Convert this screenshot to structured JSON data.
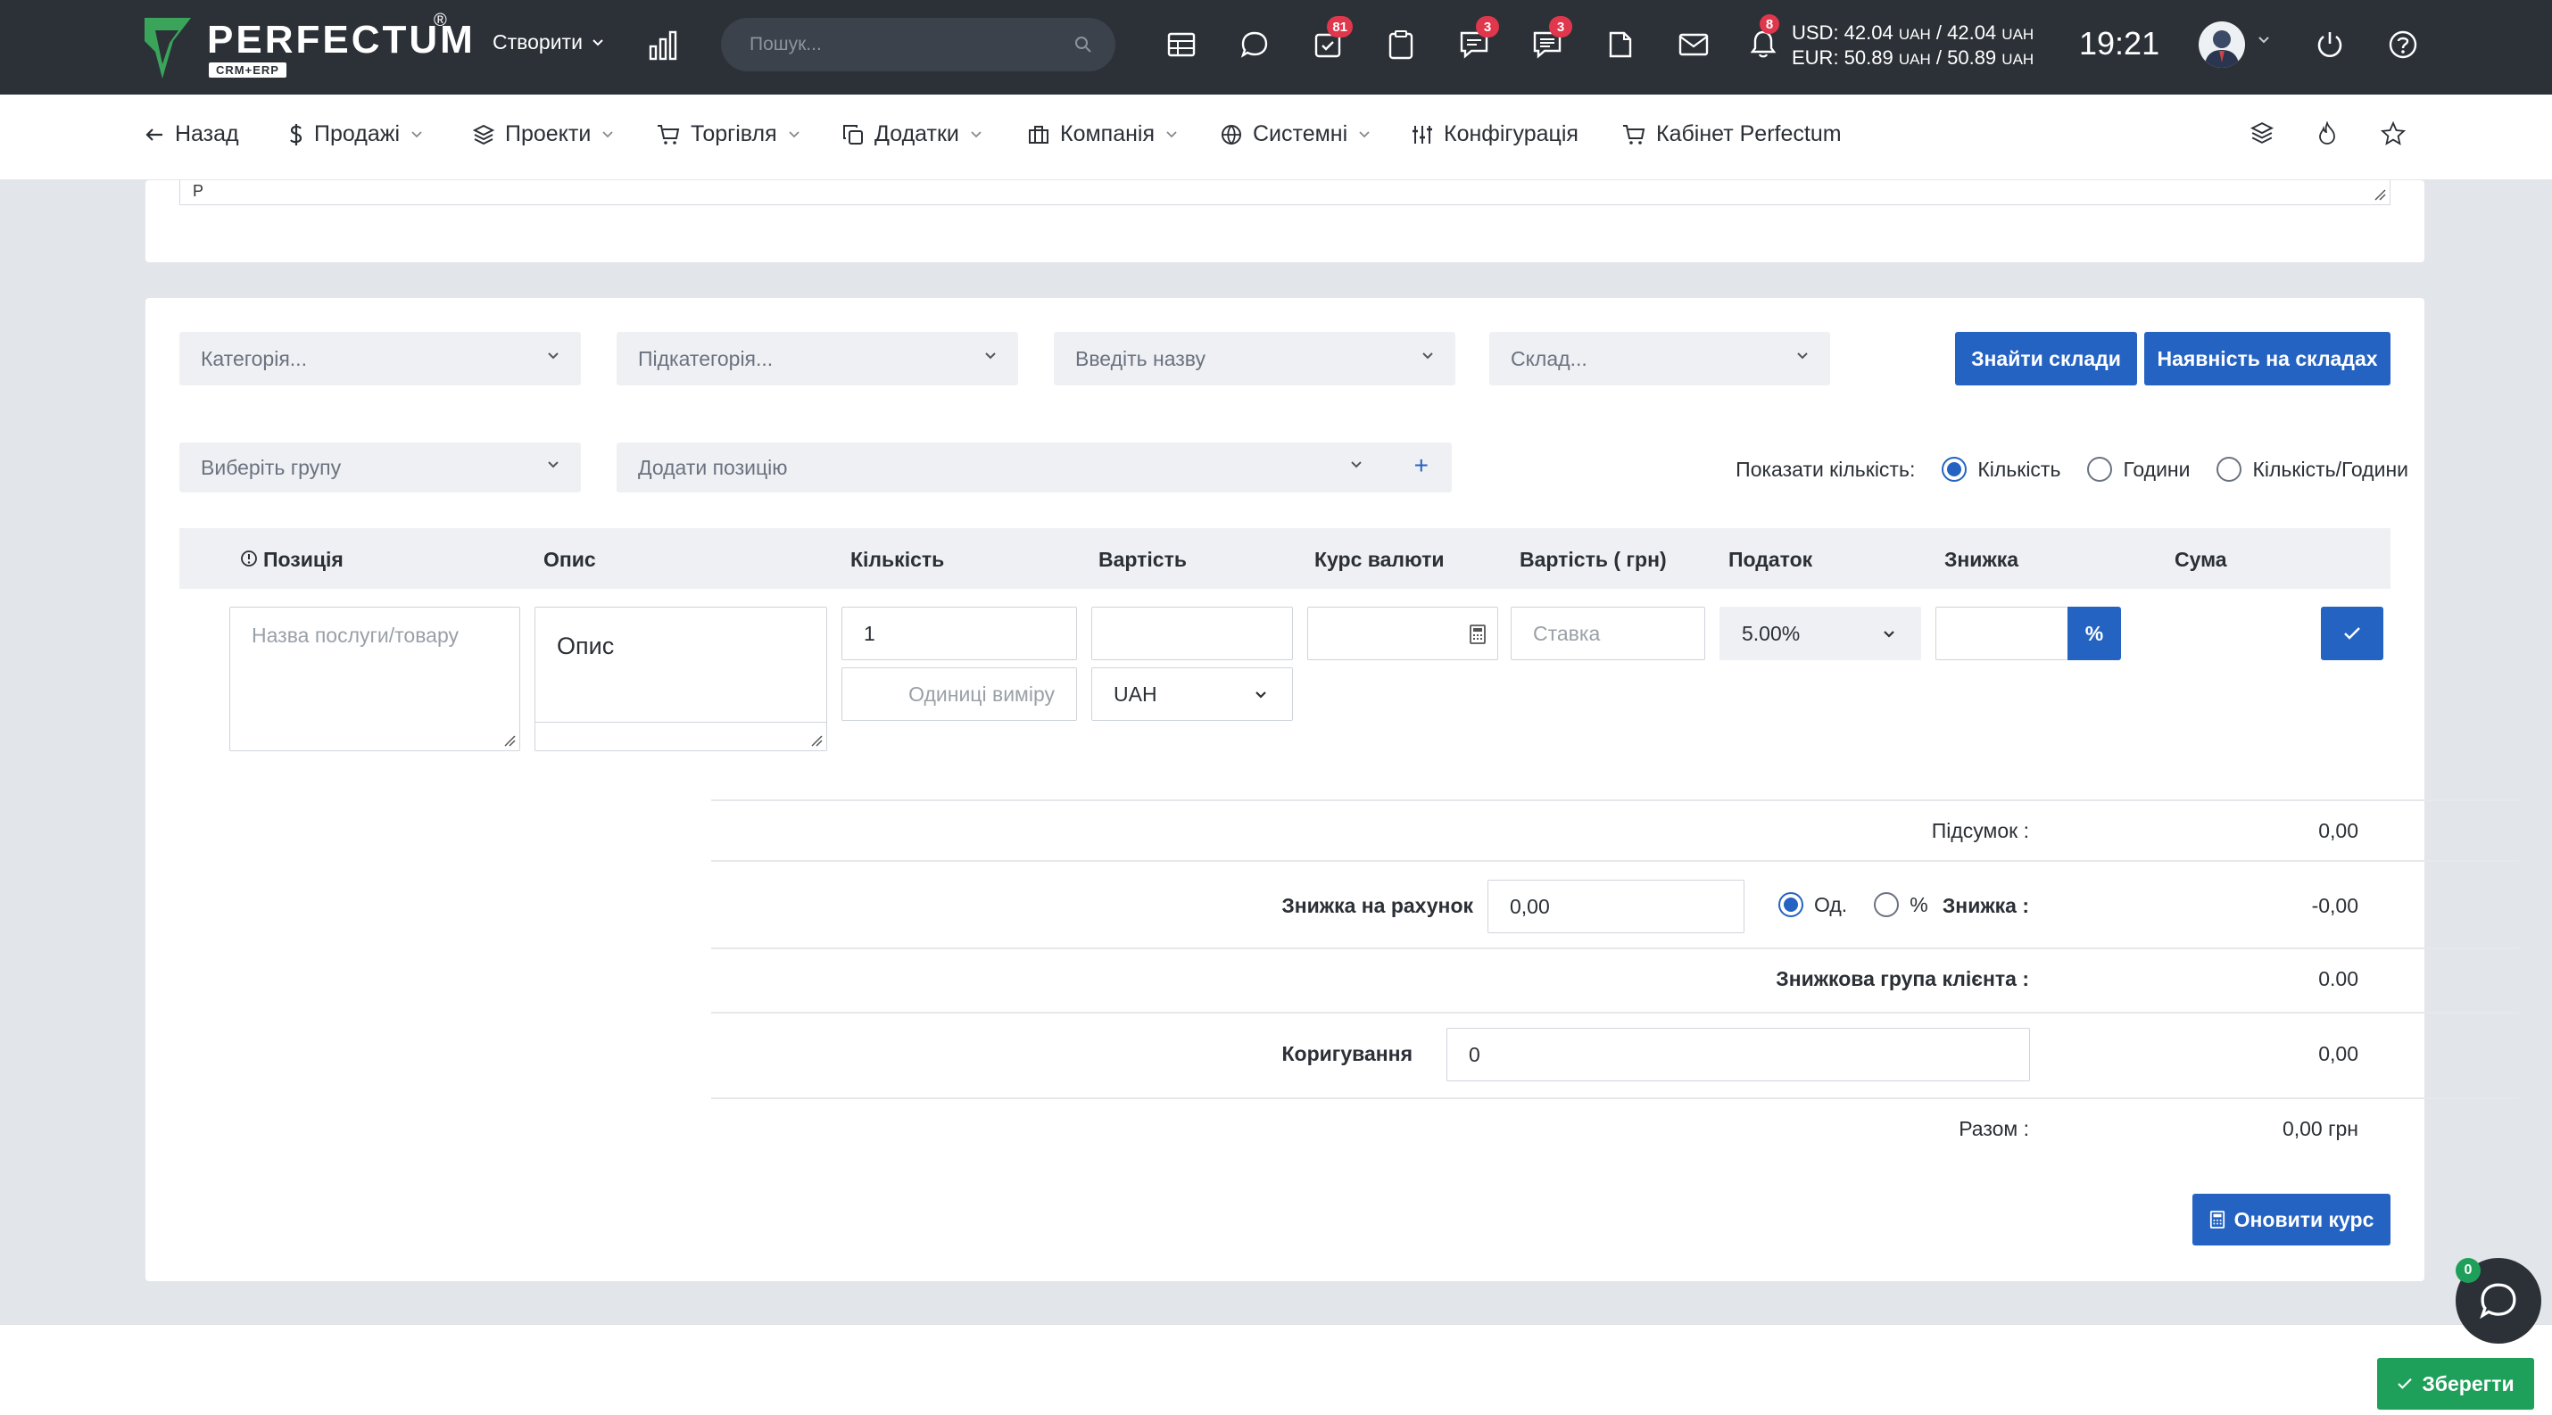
{
  "topbar": {
    "logo_text": "PERFECTUM",
    "logo_sub": "CRM+ERP",
    "logo_reg": "®",
    "create_label": "Створити",
    "search_placeholder": "Пошук...",
    "badges": {
      "tasks": "81",
      "chat": "3",
      "comments": "3",
      "notifications": "8"
    },
    "currency_usd_label": "USD: 42.04",
    "currency_usd_mid": "/ 42.04",
    "currency_eur_label": "EUR: 50.89",
    "currency_eur_mid": "/ 50.89",
    "currency_unit": "UAH",
    "clock": "19:21"
  },
  "nav": {
    "back": "Назад",
    "sales": "Продажі",
    "projects": "Проекти",
    "trade": "Торгівля",
    "addons": "Додатки",
    "company": "Компанія",
    "system": "Системні",
    "config": "Конфігурація",
    "cabinet": "Кабінет Perfectum"
  },
  "top_card": {
    "textarea_value": "Р"
  },
  "filters": {
    "category": "Категорія...",
    "subcategory": "Підкатегорія...",
    "name": "Введіть назву",
    "warehouse": "Склад...",
    "find_warehouses": "Знайти склади",
    "stock_availability": "Наявність на складах",
    "group": "Виберіть групу",
    "add_position": "Додати позицію",
    "add_plus": "+"
  },
  "show_qty": {
    "label": "Показати кількість:",
    "options": [
      "Кількість",
      "Години",
      "Кількість/Години"
    ],
    "selected": "Кількість"
  },
  "table": {
    "headers": [
      "Позиція",
      "Опис",
      "Кількість",
      "Вартість",
      "Курс валюти",
      "Вартість ( грн)",
      "Податок",
      "Знижка",
      "Сума"
    ],
    "row": {
      "position_placeholder": "Назва послуги/товару",
      "description": "Опис",
      "quantity": "1",
      "units_placeholder": "Одиниці виміру",
      "cost": "",
      "currency": "UAH",
      "rate": "",
      "cost_uah_placeholder": "Ставка",
      "tax": "5.00%",
      "discount": "",
      "discount_unit": "%"
    }
  },
  "summary": {
    "subtotal_label": "Підсумок :",
    "subtotal_value": "0,00",
    "invoice_discount_label": "Знижка на рахунок",
    "invoice_discount_value": "0,00",
    "discount_mode_options": [
      "Од.",
      "%"
    ],
    "discount_mode_selected": "Од.",
    "discount_label": "Знижка :",
    "discount_value": "-0,00",
    "client_group_label": "Знижкова група клієнта :",
    "client_group_value": "0.00",
    "adjustment_label": "Коригування",
    "adjustment_input": "0",
    "adjustment_value": "0,00",
    "total_label": "Разом :",
    "total_value": "0,00 грн",
    "update_rate": "Оновити курс"
  },
  "footer": {
    "save": "Зберегти",
    "chat_count": "0"
  },
  "colors": {
    "topbar": "#2c3138",
    "primary": "#2563c2",
    "success": "#1fa05a",
    "badge": "#e0374c",
    "logo_green": "#3aa55a"
  }
}
